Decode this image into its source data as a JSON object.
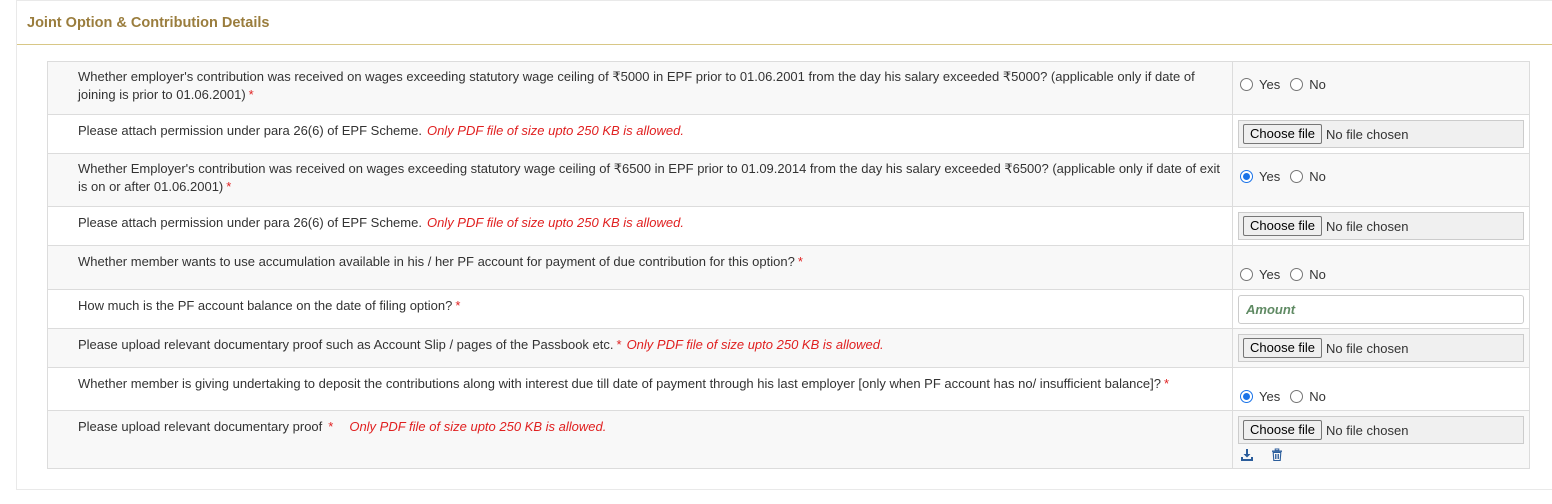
{
  "panel": {
    "title": "Joint Option & Contribution Details"
  },
  "rows": [
    {
      "question": "Whether employer's contribution was received on wages exceeding statutory wage ceiling of ₹5000 in EPF prior to 01.06.2001 from the day his salary exceeded ₹5000? (applicable only if date of joining is prior to 01.06.2001)",
      "required": "*",
      "yes_label": "Yes",
      "no_label": "No",
      "selected": "none"
    },
    {
      "question": "Please attach permission under para 26(6) of EPF Scheme.",
      "note": "Only PDF file of size upto 250 KB is allowed.",
      "file_button": "Choose file",
      "file_status": "No file chosen"
    },
    {
      "question": "Whether Employer's contribution was received on wages exceeding statutory wage ceiling of ₹6500 in EPF prior to 01.09.2014 from the day his salary exceeded ₹6500? (applicable only if date of exit is on or after 01.06.2001)",
      "required": "*",
      "yes_label": "Yes",
      "no_label": "No",
      "selected": "yes"
    },
    {
      "question": "Please attach permission under para 26(6) of EPF Scheme.",
      "note": "Only PDF file of size upto 250 KB is allowed.",
      "file_button": "Choose file",
      "file_status": "No file chosen"
    },
    {
      "question": "Whether member wants to use accumulation available in his / her PF account for payment of due contribution for this option?",
      "required": "*",
      "yes_label": "Yes",
      "no_label": "No",
      "selected": "none"
    },
    {
      "question": "How much is the PF account balance on the date of filing option?",
      "required": "*",
      "placeholder": "Amount",
      "value": ""
    },
    {
      "question": "Please upload relevant documentary proof such as Account Slip / pages of the Passbook etc.",
      "required": "*",
      "note": "Only PDF file of size upto 250 KB is allowed.",
      "file_button": "Choose file",
      "file_status": "No file chosen"
    },
    {
      "question": "Whether member is giving undertaking to deposit the contributions along with interest due till date of payment through his last employer [only when PF account has no/ insufficient balance]?",
      "required": "*",
      "yes_label": "Yes",
      "no_label": "No",
      "selected": "yes"
    },
    {
      "question": "Please upload relevant documentary proof",
      "required": "*",
      "note": "Only PDF file of size upto 250 KB is allowed.",
      "file_button": "Choose file",
      "file_status": "No file chosen",
      "icons": [
        "download-icon",
        "trash-icon"
      ]
    }
  ],
  "colors": {
    "title": "#9a7d3d",
    "required": "#e02020",
    "radio_checked": "#1a73e8",
    "placeholder": "#5f8a63"
  }
}
